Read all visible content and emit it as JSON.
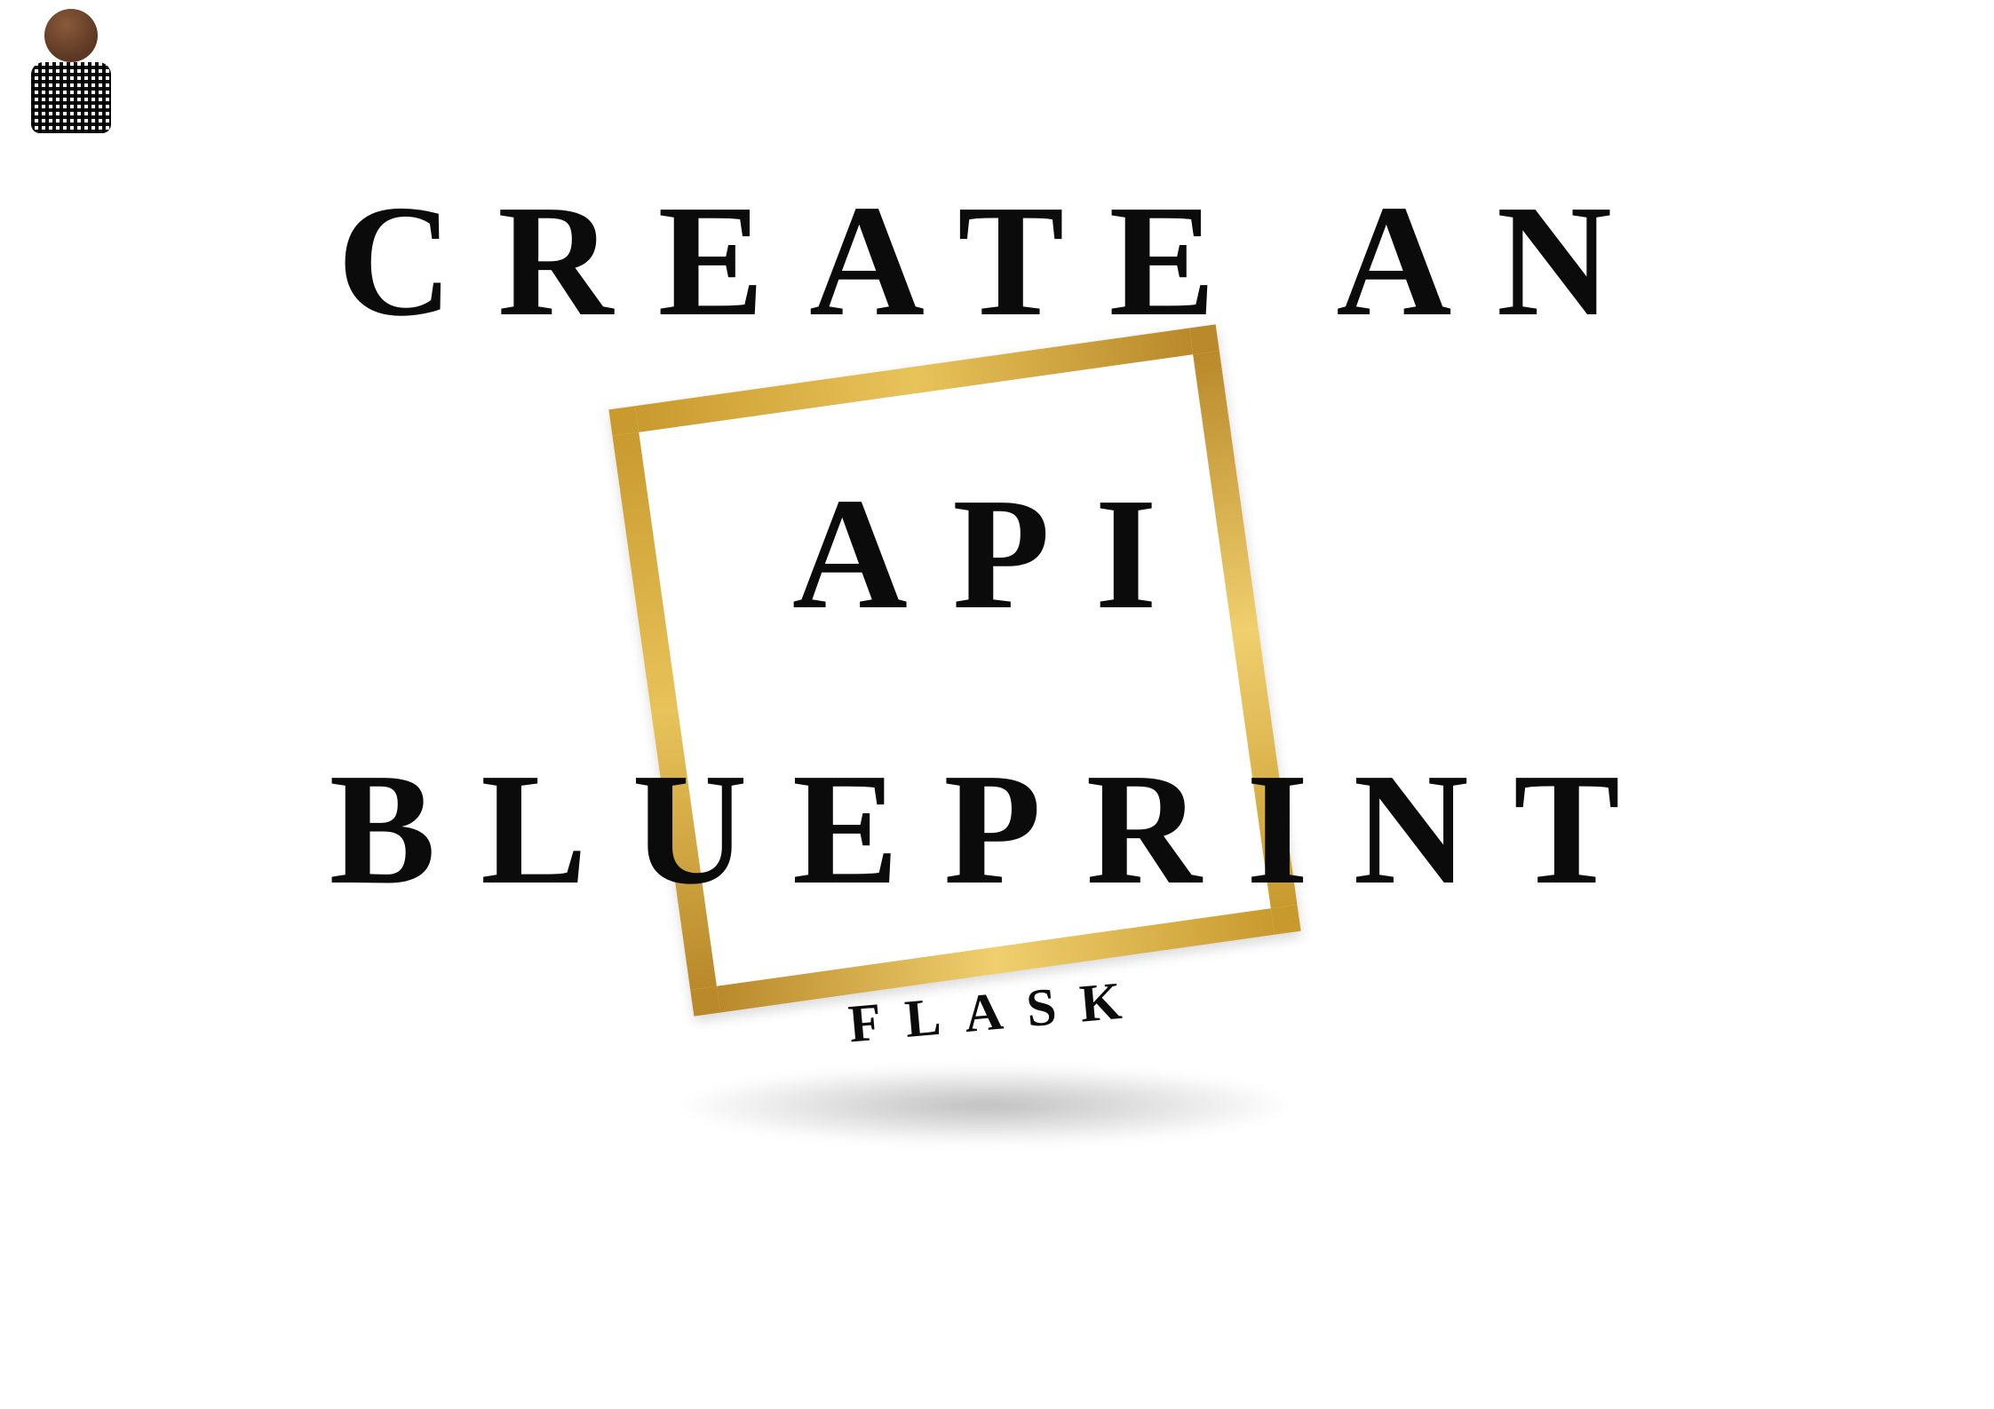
{
  "title": {
    "line1": "CREATE AN",
    "line2": "API",
    "line3": "BLUEPRINT"
  },
  "subtitle": "FLASK",
  "colors": {
    "text": "#0b0b0b",
    "gold_light": "#f0cf6e",
    "gold_mid": "#e8c35a",
    "gold_dark": "#b9892a",
    "background": "#ffffff"
  },
  "icons": {
    "avatar": "person-avatar"
  }
}
